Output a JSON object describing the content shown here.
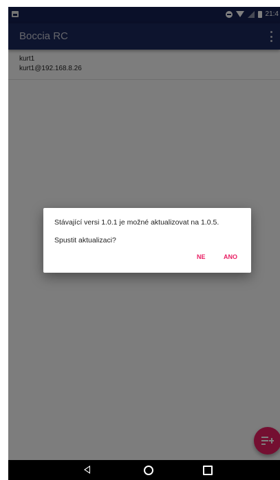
{
  "status_bar": {
    "time": "21:4"
  },
  "app_bar": {
    "title": "Boccia RC",
    "overflow_icon": "more-vert-icon"
  },
  "list": {
    "items": [
      {
        "title": "kurt1",
        "subtitle": "kurt1@192.168.8.26"
      }
    ]
  },
  "dialog": {
    "message": "Stávající versi 1.0.1 je možné aktualizovat na 1.0.5.",
    "question": "Spustit aktualizaci?",
    "negative_label": "NE",
    "positive_label": "ANO"
  },
  "fab": {
    "icon": "playlist-add-icon"
  },
  "nav_bar": {
    "back_icon": "back-icon",
    "home_icon": "home-icon",
    "recents_icon": "recents-icon"
  },
  "colors": {
    "primary": "#1b285d",
    "primary_dark": "#152052",
    "accent": "#e91e63",
    "scrim": "rgba(0,0,0,0.5)"
  }
}
